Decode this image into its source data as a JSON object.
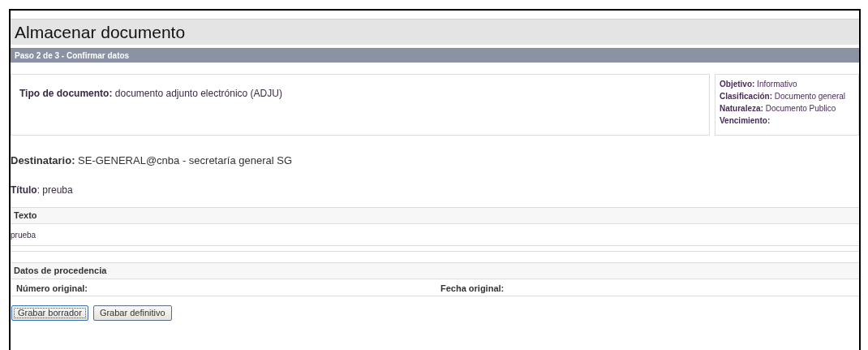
{
  "page": {
    "title": "Almacenar documento",
    "step": "Paso 2 de 3 - Confirmar datos"
  },
  "document_type": "**Tipo de documento:** documento adjunto electrónico (ADJU)",
  "properties": [
    "**Objetivo:** Informativo",
    "**Clasificación:** Documento general",
    "**Naturaleza:** Documento Publico",
    "**Vencimiento:**"
  ],
  "recipient": "**Destinatario:** SE-GENERAL@cnba - secretaría general SG",
  "subject": "**Título**: preuba",
  "text_section": {
    "heading": "Texto",
    "body": "prueba"
  },
  "origin_section": {
    "heading": "Datos de procedencia",
    "fields": [
      "Número original:",
      "Fecha original:"
    ]
  },
  "buttons": [
    {
      "label": "Grabar borrador",
      "focused": true
    },
    {
      "label": "Grabar definitivo",
      "focused": false
    }
  ]
}
